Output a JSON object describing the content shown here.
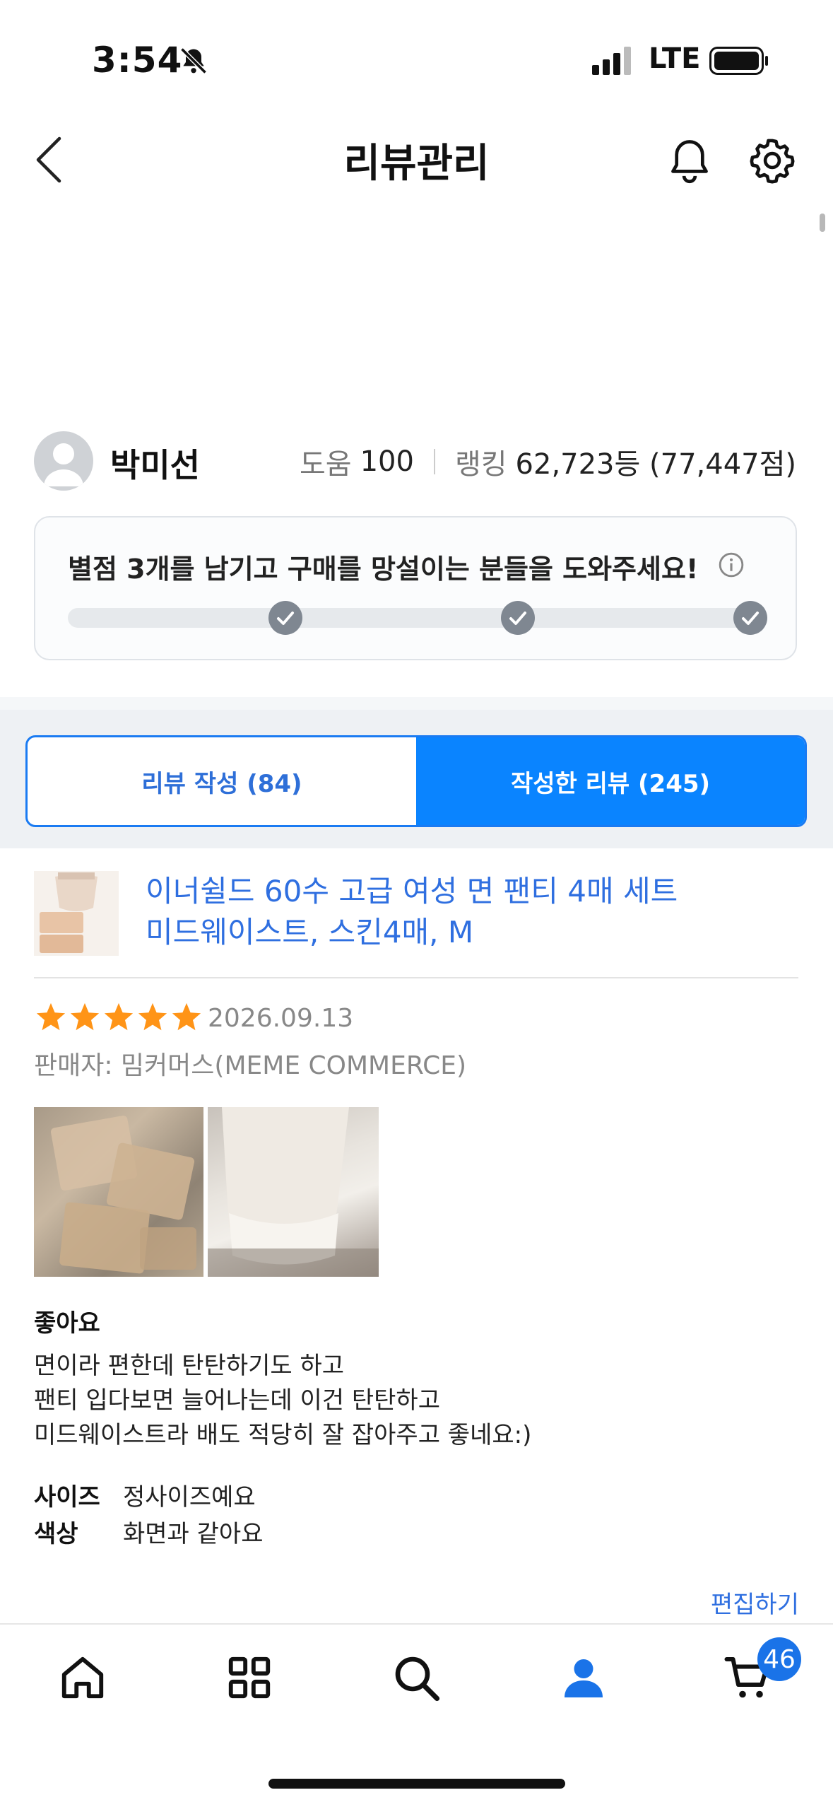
{
  "status_bar": {
    "time": "3:54",
    "network": "LTE",
    "icons": [
      "bell-slash-icon",
      "signal-icon",
      "battery-icon"
    ]
  },
  "header": {
    "title": "리뷰관리",
    "icons": [
      "back-chevron-icon",
      "bell-icon",
      "gear-icon"
    ]
  },
  "profile": {
    "name": "박미선",
    "help_label": "도움",
    "help_value": "100",
    "rank_label": "랭킹",
    "rank_value": "62,723등 (77,447점)"
  },
  "promo": {
    "text": "별점 3개를 남기고 구매를 망설이는 분들을 도와주세요!",
    "completed_steps": 3,
    "total_steps": 3
  },
  "tabs": [
    {
      "label": "리뷰 작성 (84)",
      "active": false
    },
    {
      "label": "작성한 리뷰 (245)",
      "active": true
    }
  ],
  "review": {
    "product_title_line1": "이너쉴드 60수 고급 여성 면 팬티 4매 세트",
    "product_title_line2": "미드웨이스트, 스킨4매, M",
    "rating": 5,
    "date": "2026.09.13",
    "seller": "판매자: 밈커머스(MEME COMMERCE)",
    "headline": "좋아요",
    "body_lines": [
      "면이라 편한데 탄탄하기도 하고",
      "팬티 입다보면 늘어나는데 이건 탄탄하고",
      "미드웨이스트라 배도 적당히 잘 잡아주고 좋네요:)"
    ],
    "attributes": [
      {
        "label": "사이즈",
        "value": "정사이즈예요"
      },
      {
        "label": "색상",
        "value": "화면과 같아요"
      }
    ],
    "edit_label": "편집하기"
  },
  "bottom_nav": {
    "items": [
      "home-icon",
      "category-grid-icon",
      "search-icon",
      "my-profile-icon",
      "cart-icon"
    ],
    "cart_badge": "46"
  },
  "colors": {
    "accent": "#0a84ff",
    "link": "#2f6fe0",
    "star": "#ff9417",
    "muted": "#888888"
  }
}
